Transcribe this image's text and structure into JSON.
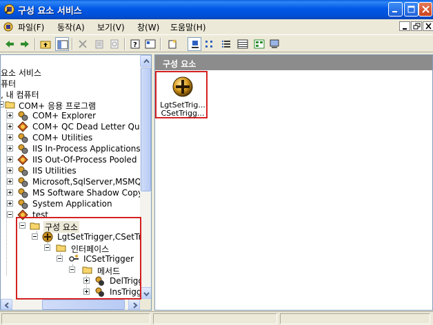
{
  "window": {
    "title": "구성 요소 서비스"
  },
  "menu": [
    {
      "label": "파일(F)"
    },
    {
      "label": "동작(A)"
    },
    {
      "label": "보기(V)"
    },
    {
      "label": "창(W)"
    },
    {
      "label": "도움말(H)"
    }
  ],
  "tree": {
    "rows": [
      {
        "label": "요소 서비스"
      },
      {
        "label": "퓨터"
      },
      {
        "label": ", 내 컴퓨터"
      },
      {
        "label": "COM+ 응용 프로그램"
      },
      {
        "label": "COM+ Explorer"
      },
      {
        "label": "COM+ QC Dead Letter Queue"
      },
      {
        "label": "COM+ Utilities"
      },
      {
        "label": "IIS In-Process Applications"
      },
      {
        "label": "IIS Out-Of-Process Pooled"
      },
      {
        "label": "IIS Utilities"
      },
      {
        "label": "Microsoft,SqlServer,MSMQT"
      },
      {
        "label": "MS Software Shadow Copy"
      },
      {
        "label": "System Application"
      },
      {
        "label": "test"
      },
      {
        "label": "구성 요소"
      },
      {
        "label": "LgtSetTrigger,CSetTrigger"
      },
      {
        "label": "인터페이스"
      },
      {
        "label": "ICSetTrigger"
      },
      {
        "label": "메서드"
      },
      {
        "label": "DelTrigger"
      },
      {
        "label": "InsTrigger"
      }
    ]
  },
  "result": {
    "header": "구성 요소",
    "item": {
      "line1": "LgtSetTrig...",
      "line2": "CSetTrigg..."
    }
  },
  "colors": {
    "titlebar": "#0058e6",
    "highlight": "#d42020",
    "pane_header": "#8c8c8c"
  }
}
